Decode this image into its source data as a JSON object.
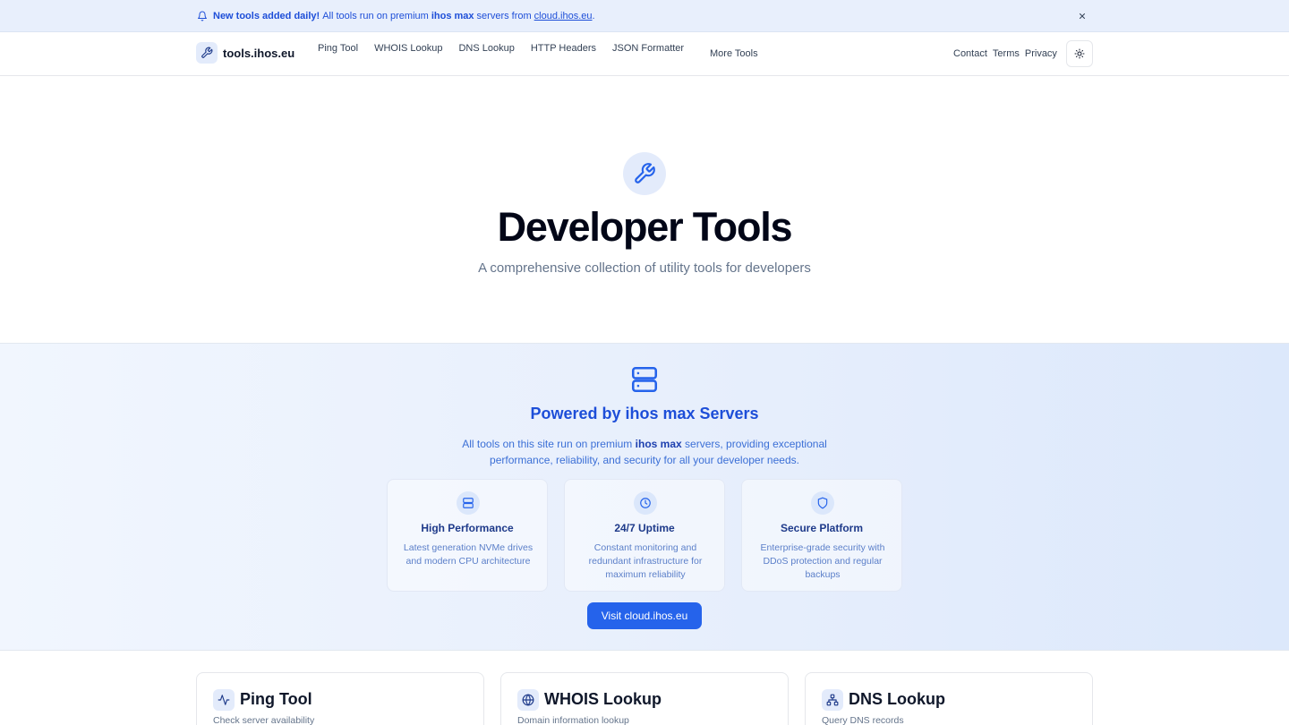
{
  "announcement": {
    "bold": "New tools added daily!",
    "text": "All tools run on premium",
    "brand": "ihos max",
    "text2": "servers from",
    "link": "cloud.ihos.eu",
    "suffix": "."
  },
  "nav": {
    "brand": "tools.ihos.eu",
    "links": [
      "Ping Tool",
      "WHOIS Lookup",
      "DNS Lookup",
      "HTTP Headers",
      "JSON Formatter"
    ],
    "more": "More Tools",
    "right": [
      "Contact",
      "Terms",
      "Privacy"
    ]
  },
  "hero": {
    "title": "Developer Tools",
    "subtitle": "A comprehensive collection of utility tools for developers"
  },
  "powered": {
    "title": "Powered by ihos max Servers",
    "desc_1": "All tools on this site run on premium",
    "desc_brand": "ihos max",
    "desc_2": "servers, providing exceptional performance, reliability, and security for all your developer needs.",
    "features": [
      {
        "title": "High Performance",
        "desc": "Latest generation NVMe drives and modern CPU architecture",
        "icon": "server-icon"
      },
      {
        "title": "24/7 Uptime",
        "desc": "Constant monitoring and redundant infrastructure for maximum reliability",
        "icon": "clock-icon"
      },
      {
        "title": "Secure Platform",
        "desc": "Enterprise-grade security with DDoS protection and regular backups",
        "icon": "shield-icon"
      }
    ],
    "button": "Visit cloud.ihos.eu"
  },
  "tools": [
    {
      "title": "Ping Tool",
      "desc": "Check server availability",
      "icon": "activity-icon"
    },
    {
      "title": "WHOIS Lookup",
      "desc": "Domain information lookup",
      "icon": "globe-icon"
    },
    {
      "title": "DNS Lookup",
      "desc": "Query DNS records",
      "icon": "network-icon"
    }
  ],
  "colors": {
    "accent": "#2563eb",
    "banner_bg": "#e8effc",
    "powered_title": "#1d4ed8"
  }
}
